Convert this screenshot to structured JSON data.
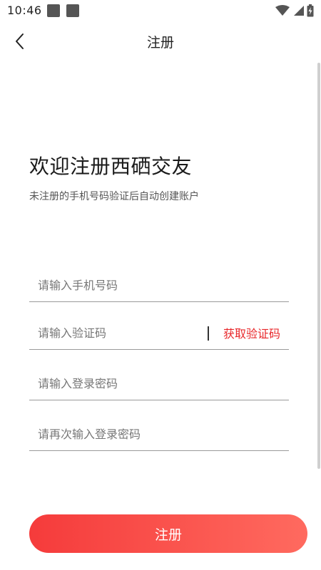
{
  "status_bar": {
    "time": "10:46",
    "icons": [
      "notification-square-icon",
      "notification-square-icon",
      "wifi-icon",
      "signal-icon",
      "battery-charging-icon"
    ]
  },
  "header": {
    "title": "注册",
    "back_icon": "chevron-left-icon"
  },
  "welcome": {
    "title": "欢迎注册西硒交友",
    "subtitle": "未注册的手机号码验证后自动创建账户"
  },
  "form": {
    "phone_placeholder": "请输入手机号码",
    "code_placeholder": "请输入验证码",
    "get_code_label": "获取验证码",
    "password_placeholder": "请输入登录密码",
    "password_confirm_placeholder": "请再次输入登录密码",
    "submit_label": "注册"
  },
  "colors": {
    "accent": "#e8272a",
    "button_gradient_start": "#f53b3b",
    "button_gradient_end": "#ff6a5f"
  }
}
